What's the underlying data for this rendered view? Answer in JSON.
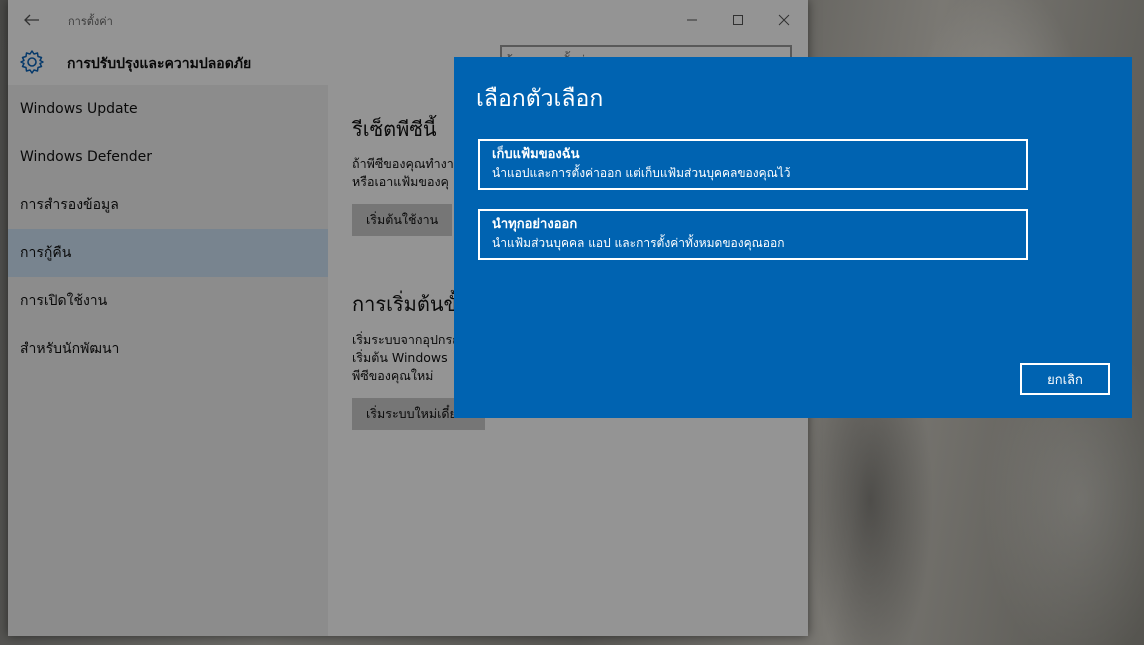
{
  "window": {
    "title": "การตั้งค่า",
    "header_title": "การปรับปรุงและความปลอดภัย",
    "search_placeholder": "ค้นหาการตั้งค่า"
  },
  "sidebar": {
    "items": [
      {
        "label": "Windows Update"
      },
      {
        "label": "Windows Defender"
      },
      {
        "label": "การสำรองข้อมูล"
      },
      {
        "label": "การกู้คืน",
        "selected": true
      },
      {
        "label": "การเปิดใช้งาน"
      },
      {
        "label": "สำหรับนักพัฒนา"
      }
    ]
  },
  "content": {
    "reset": {
      "heading": "รีเซ็ตพีซีนี้",
      "text_line1": "ถ้าพีซีของคุณทำงาน",
      "text_line2": "หรือเอาแฟ้มของคุ",
      "button": "เริ่มต้นใช้งาน"
    },
    "advanced": {
      "heading": "การเริ่มต้นขั้",
      "text_line1": "เริ่มระบบจากอุปกรณ",
      "text_line2": "เริ่มต้น Windows",
      "text_line3": "พีซีของคุณใหม่",
      "button": "เริ่มระบบใหม่เดี๋ยวนี้"
    }
  },
  "dialog": {
    "title": "เลือกตัวเลือก",
    "options": [
      {
        "title": "เก็บแฟ้มของฉัน",
        "description": "นำแอปและการตั้งค่าออก แต่เก็บแฟ้มส่วนบุคคลของคุณไว้"
      },
      {
        "title": "นำทุกอย่างออก",
        "description": "นำแฟ้มส่วนบุคคล แอป และการตั้งค่าทั้งหมดของคุณออก"
      }
    ],
    "cancel_label": "ยกเลิก"
  },
  "colors": {
    "dialog_bg": "#0063b1",
    "accent": "#0a63b8",
    "selected_nav": "#cfe3f6"
  },
  "icons": {
    "back": "back-arrow-icon",
    "gear": "gear-icon",
    "minimize": "minimize-icon",
    "maximize": "maximize-icon",
    "close": "close-icon"
  }
}
